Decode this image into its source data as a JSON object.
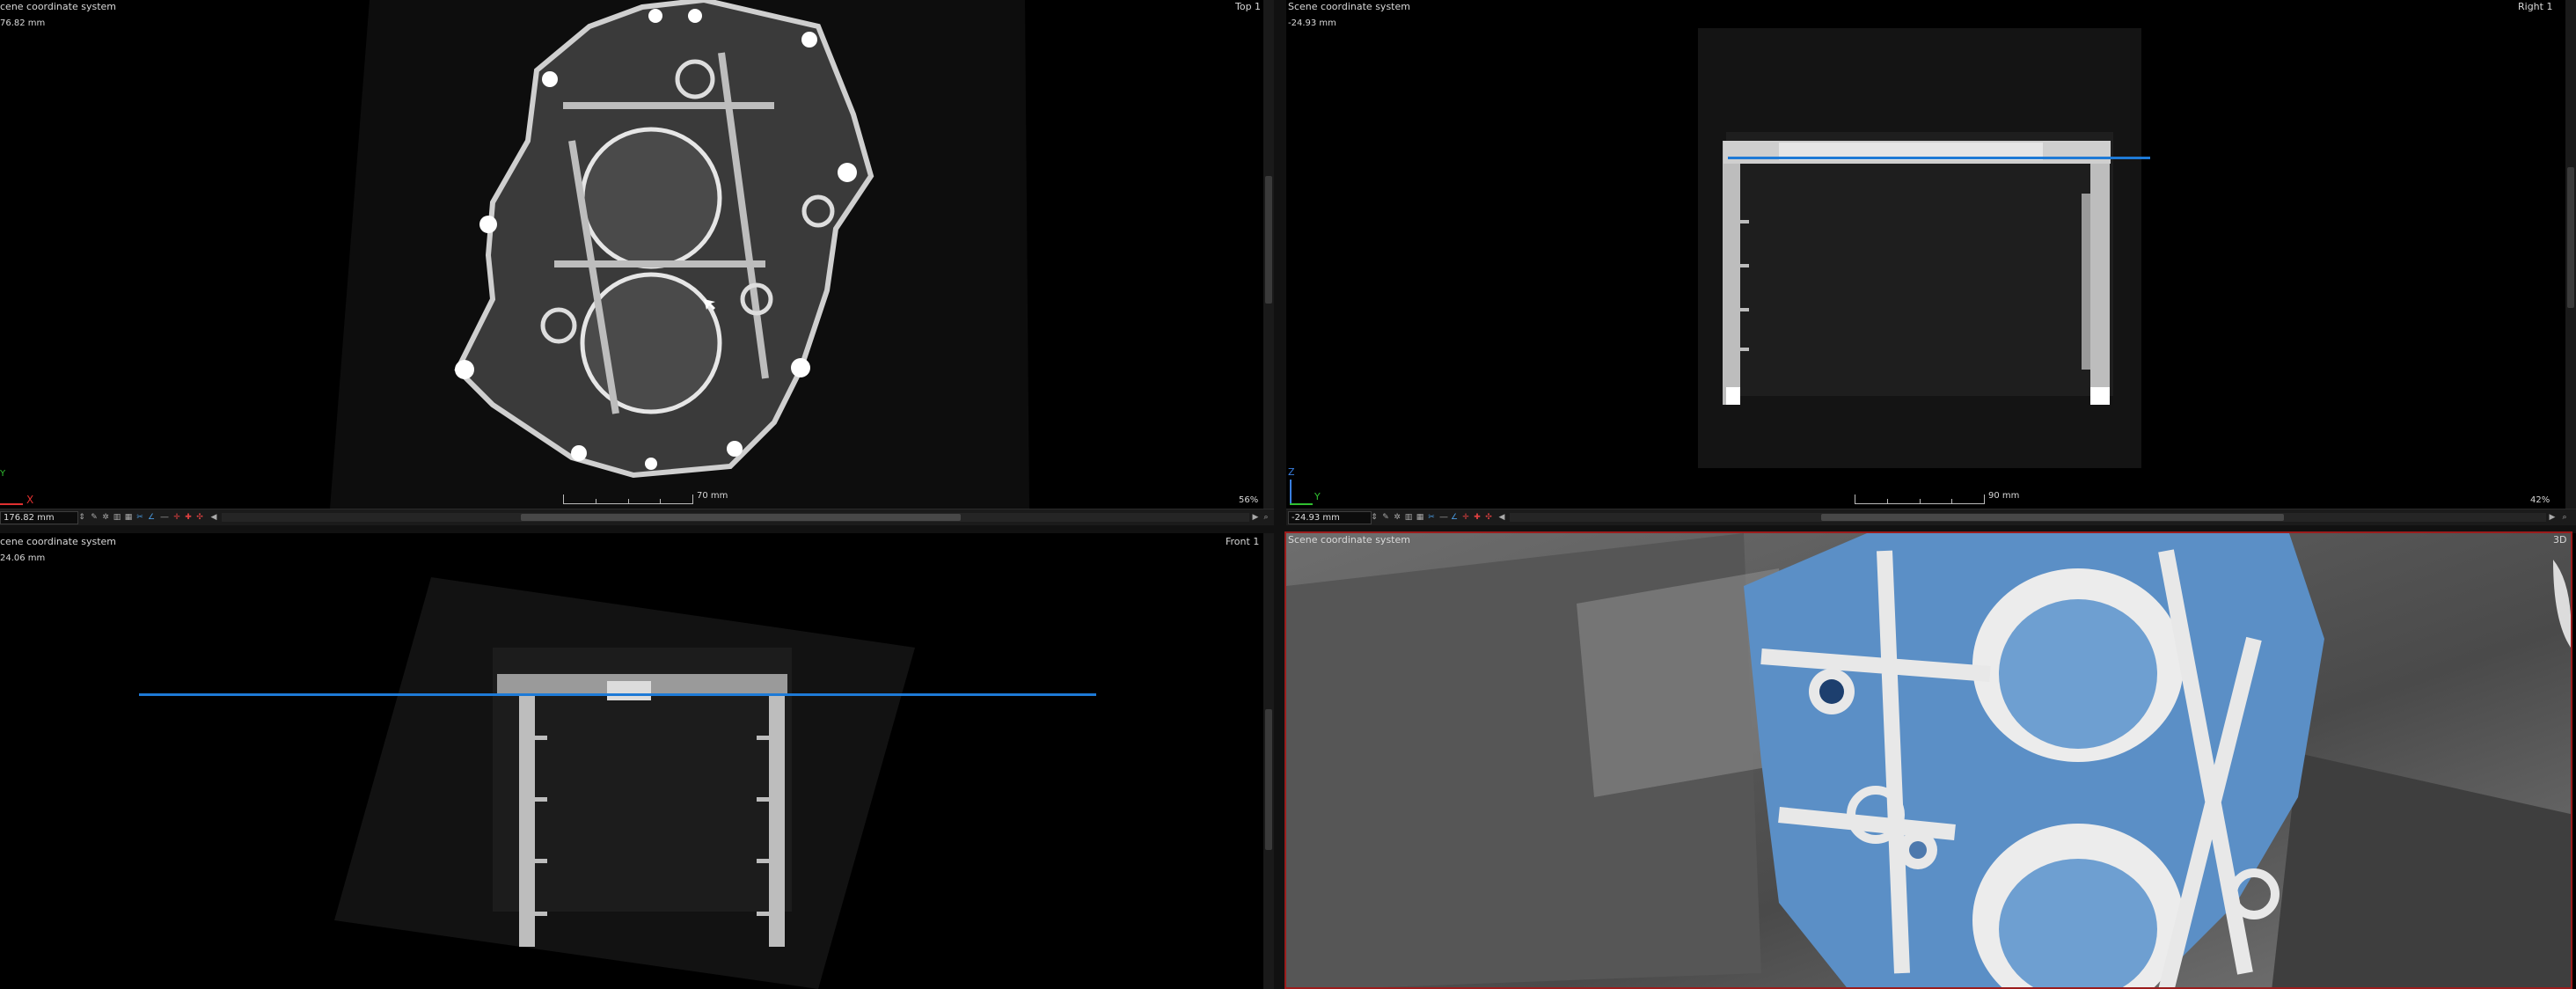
{
  "views": {
    "top": {
      "coord_system": "cene coordinate system",
      "offset": "76.82 mm",
      "name": "Top 1",
      "scale_label": "70 mm",
      "zoom": "56%",
      "position_value": "176.82 mm",
      "axis_x": "X",
      "axis_y": "Y"
    },
    "right": {
      "coord_system": "Scene coordinate system",
      "offset": "-24.93 mm",
      "name": "Right 1",
      "scale_label": "90 mm",
      "zoom": "42%",
      "position_value": "-24.93 mm",
      "axis_z": "Z",
      "axis_y": "Y"
    },
    "front": {
      "coord_system": "cene coordinate system",
      "offset": "24.06 mm",
      "name": "Front 1"
    },
    "view3d": {
      "coord_system": "Scene coordinate system",
      "name": "3D"
    }
  },
  "toolbar_icons": [
    "pin-icon",
    "gear-icon",
    "ruler-icon",
    "layout-icon",
    "grid-icon",
    "cut-icon",
    "line-icon",
    "measure-icon",
    "crosshair-icon",
    "marker-icon",
    "marker-alt-icon",
    "arrow-left-icon"
  ],
  "colors": {
    "background": "#000000",
    "accent_line": "#1e7ad6",
    "active_border": "#9b1c1c",
    "axis_x": "#e03030",
    "axis_y": "#30c030",
    "axis_z": "#3a7fe0",
    "surface_blue": "#5b8fc6"
  }
}
